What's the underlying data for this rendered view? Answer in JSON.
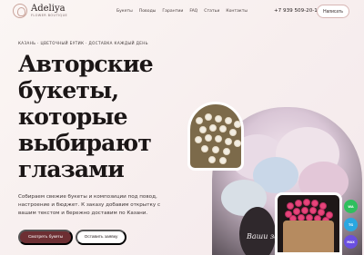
{
  "brand": {
    "name": "Adeliya",
    "subtitle": "Flower Boutique"
  },
  "nav": {
    "items": [
      "Букеты",
      "Поводы",
      "Гарантии",
      "FAQ",
      "Статьи",
      "Контакты"
    ],
    "phone": "+7 939 509-20-10",
    "write_label": "Написать"
  },
  "hero": {
    "eyebrow": "КАЗАНЬ · ЦВЕТОЧНЫЙ БУТИК · ДОСТАВКА КАЖДЫЙ ДЕНЬ",
    "title": "Авторские\nбукеты,\nкоторые\nвыбирают\nглазами",
    "description": "Собираем свежие букеты и композиции под повод, настроение и бюджет. К заказу добавим открытку с вашим текстом и бережно доставим по Казани.",
    "primary_button": "Смотреть букеты",
    "secondary_button": "Оставить заявку",
    "photo_caption": "Ваши за"
  },
  "messengers": [
    {
      "label": "WA",
      "color": "#2fbf5e"
    },
    {
      "label": "TG",
      "color": "#2aa7e0"
    },
    {
      "label": "MAX",
      "color": "#6a4fe0"
    }
  ]
}
